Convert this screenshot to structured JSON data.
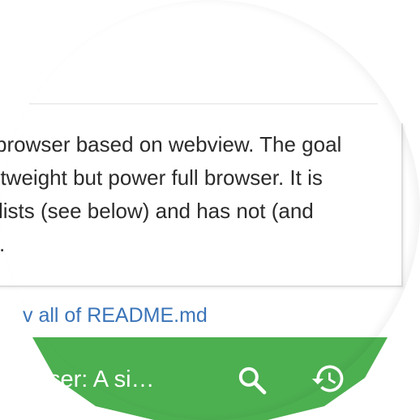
{
  "readme": {
    "lines": [
      "browser based on webview. The goal",
      "ntweight but power full browser. It is",
      "lists (see below) and has not (and",
      "s."
    ],
    "view_all_link": "v all of README.md"
  },
  "bottom_bar": {
    "title": "ser: A si…",
    "color": "#4caf50",
    "search_icon": "search-icon",
    "history_icon": "history-icon"
  },
  "colors": {
    "link": "#3a74b8",
    "text": "#2b2b2b"
  }
}
